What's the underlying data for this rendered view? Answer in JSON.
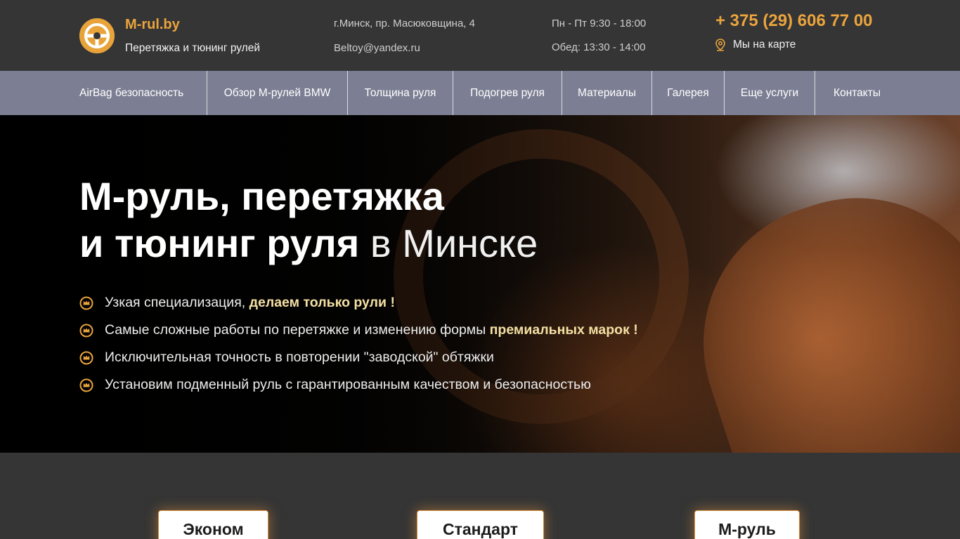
{
  "header": {
    "brand": "M-rul.by",
    "tagline": "Перетяжка и тюнинг рулей",
    "address": "г.Минск, пр. Масюковщина, 4",
    "email": "Beltoy@yandex.ru",
    "hours": "Пн - Пт 9:30 - 18:00",
    "lunch": "Обед: 13:30 - 14:00",
    "phone": "+ 375 (29) 606 77 00",
    "map_label": "Мы на карте",
    "icons": {
      "logo": "steering-wheel-icon",
      "map": "map-pin-icon"
    }
  },
  "nav": {
    "items": [
      "AirBag безопасность",
      "Обзор М-рулей BMW",
      "Толщина руля",
      "Подогрев руля",
      "Материалы",
      "Галерея",
      "Еще услуги",
      "Контакты"
    ]
  },
  "hero": {
    "title_line1": "М-руль, перетяжка",
    "title_line2_bold": "и тюнинг руля",
    "title_line2_light": " в Минске",
    "features": [
      {
        "text": "Узкая специализация, ",
        "highlight": "делаем только рули !"
      },
      {
        "text": "Самые сложные работы по перетяжке и изменению формы ",
        "highlight": "премиальных марок !"
      },
      {
        "text": "Исключительная точность в повторении \"заводской\" обтяжки",
        "highlight": ""
      },
      {
        "text": "Установим подменный руль с гарантированным качеством и безопасностью",
        "highlight": ""
      }
    ],
    "feature_icon": "crown-badge-icon"
  },
  "plans": {
    "items": [
      "Эконом",
      "Стандарт",
      "М-руль"
    ]
  },
  "colors": {
    "accent": "#eba43d",
    "nav_bg": "#7c7f93",
    "header_bg": "#353535",
    "highlight": "#f4e0a3"
  }
}
